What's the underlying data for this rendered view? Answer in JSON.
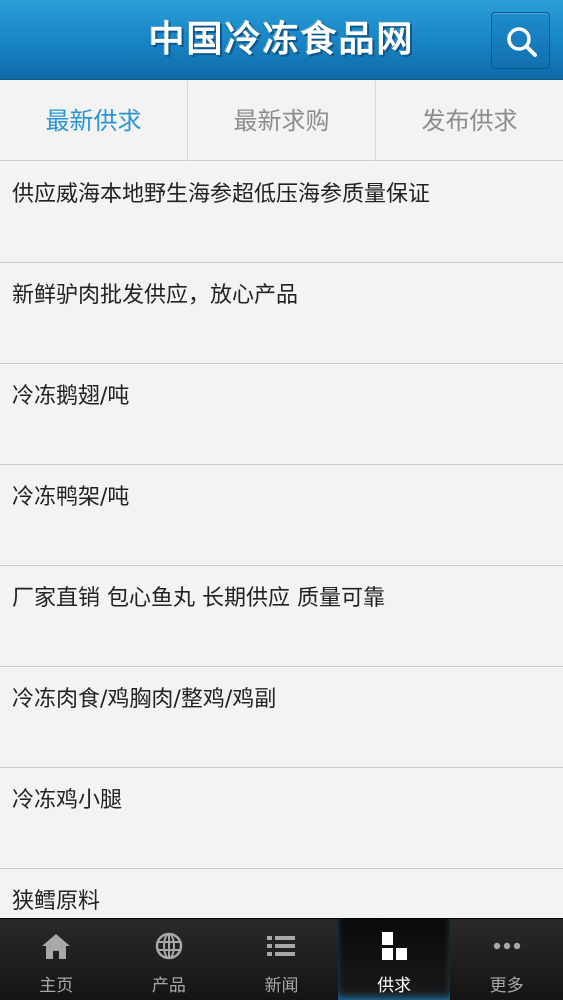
{
  "header": {
    "title": "中国冷冻食品网",
    "search_icon": "search-icon"
  },
  "tabs": [
    {
      "label": "最新供求",
      "active": true
    },
    {
      "label": "最新求购",
      "active": false
    },
    {
      "label": "发布供求",
      "active": false
    }
  ],
  "list": {
    "items": [
      {
        "title": "供应威海本地野生海参超低压海参质量保证"
      },
      {
        "title": "新鲜驴肉批发供应，放心产品"
      },
      {
        "title": "冷冻鹅翅/吨"
      },
      {
        "title": "冷冻鸭架/吨"
      },
      {
        "title": "厂家直销 包心鱼丸 长期供应 质量可靠"
      },
      {
        "title": "冷冻肉食/鸡胸肉/整鸡/鸡副"
      },
      {
        "title": "冷冻鸡小腿"
      },
      {
        "title": "狭鳕原料"
      }
    ]
  },
  "bottom_nav": [
    {
      "label": "主页",
      "icon": "home-icon",
      "active": false
    },
    {
      "label": "产品",
      "icon": "globe-icon",
      "active": false
    },
    {
      "label": "新闻",
      "icon": "list-icon",
      "active": false
    },
    {
      "label": "供求",
      "icon": "grid-icon",
      "active": true
    },
    {
      "label": "更多",
      "icon": "more-icon",
      "active": false
    }
  ],
  "colors": {
    "header": "#1783c4",
    "active_tab": "#2a95d6",
    "nav_bg": "#1e1e1e"
  }
}
